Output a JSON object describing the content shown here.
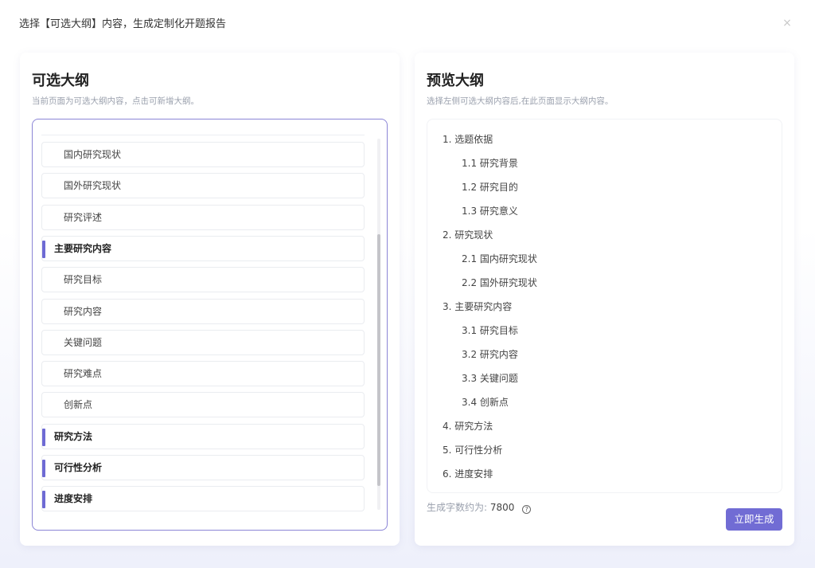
{
  "dialog": {
    "title": "选择【可选大纲】内容，生成定制化开题报告",
    "close_symbol": "×"
  },
  "left_panel": {
    "title": "可选大纲",
    "subtitle": "当前页面为可选大纲内容，点击可新增大纲。",
    "items": [
      {
        "label": "国内研究现状",
        "level": "sub"
      },
      {
        "label": "国外研究现状",
        "level": "sub"
      },
      {
        "label": "研究评述",
        "level": "sub"
      },
      {
        "label": "主要研究内容",
        "level": "main"
      },
      {
        "label": "研究目标",
        "level": "sub"
      },
      {
        "label": "研究内容",
        "level": "sub"
      },
      {
        "label": "关键问题",
        "level": "sub"
      },
      {
        "label": "研究难点",
        "level": "sub"
      },
      {
        "label": "创新点",
        "level": "sub"
      },
      {
        "label": "研究方法",
        "level": "main"
      },
      {
        "label": "可行性分析",
        "level": "main"
      },
      {
        "label": "进度安排",
        "level": "main"
      }
    ]
  },
  "right_panel": {
    "title": "预览大纲",
    "subtitle": "选择左侧可选大纲内容后,在此页面显示大纲内容。",
    "items": [
      {
        "label": "1. 选题依据",
        "level": 1
      },
      {
        "label": "1.1 研究背景",
        "level": 2
      },
      {
        "label": "1.2 研究目的",
        "level": 2
      },
      {
        "label": "1.3 研究意义",
        "level": 2
      },
      {
        "label": "2. 研究现状",
        "level": 1
      },
      {
        "label": "2.1 国内研究现状",
        "level": 2
      },
      {
        "label": "2.2 国外研究现状",
        "level": 2
      },
      {
        "label": "3. 主要研究内容",
        "level": 1
      },
      {
        "label": "3.1 研究目标",
        "level": 2
      },
      {
        "label": "3.2 研究内容",
        "level": 2
      },
      {
        "label": "3.3 关键问题",
        "level": 2
      },
      {
        "label": "3.4 创新点",
        "level": 2
      },
      {
        "label": "4. 研究方法",
        "level": 1
      },
      {
        "label": "5. 可行性分析",
        "level": 1
      },
      {
        "label": "6. 进度安排",
        "level": 1
      }
    ],
    "word_count_label": "生成字数约为:",
    "word_count_value": "7800",
    "help_symbol": "?",
    "generate_button": "立即生成"
  },
  "colors": {
    "accent": "#716cd4",
    "border_accent": "#8b85d6"
  }
}
